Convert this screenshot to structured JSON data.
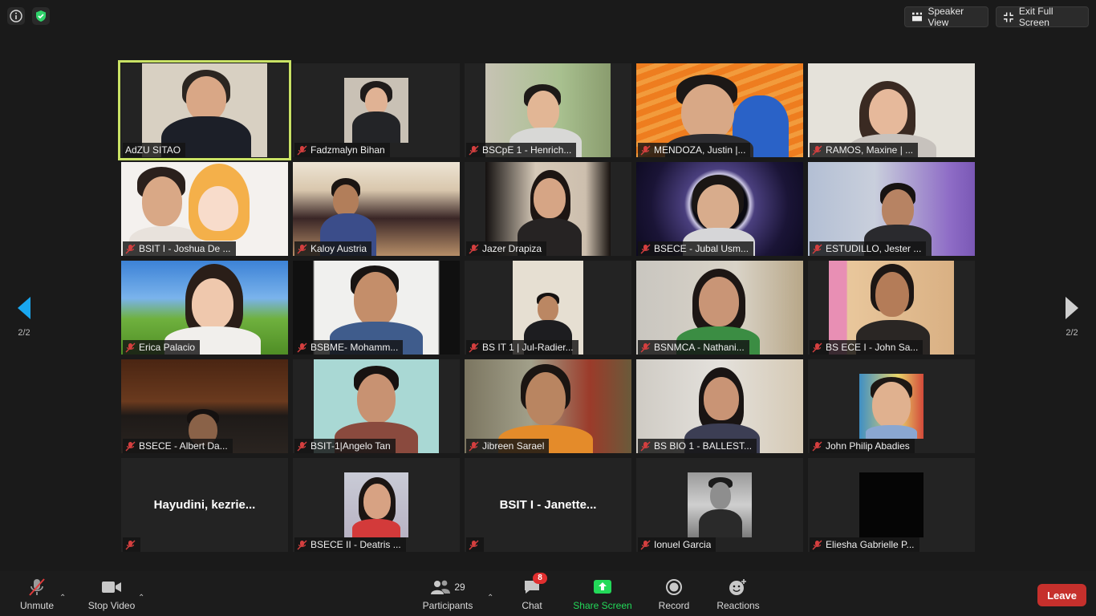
{
  "top": {
    "speaker_view_label": "Speaker View",
    "exit_fullscreen_label": "Exit Full Screen"
  },
  "pager": {
    "left": "2/2",
    "right": "2/2"
  },
  "participants": [
    {
      "name": "AdZU SITAO",
      "muted": false,
      "active": true
    },
    {
      "name": "Fadzmalyn Bihan",
      "muted": true
    },
    {
      "name": "BSCpE 1 - Henrich...",
      "muted": true
    },
    {
      "name": "MENDOZA, Justin |...",
      "muted": true
    },
    {
      "name": "RAMOS, Maxine | ...",
      "muted": true
    },
    {
      "name": "BSIT I - Joshua De ...",
      "muted": true
    },
    {
      "name": "Kaloy Austria",
      "muted": true
    },
    {
      "name": "Jazer Drapiza",
      "muted": true
    },
    {
      "name": "BSECE - Jubal Usm...",
      "muted": true
    },
    {
      "name": "ESTUDILLO, Jester ...",
      "muted": true
    },
    {
      "name": "Erica Palacio",
      "muted": true
    },
    {
      "name": "BSBME- Mohamm...",
      "muted": true
    },
    {
      "name": "BS IT 1 | Jul-Radier...",
      "muted": true
    },
    {
      "name": "BSNMCA - Nathani...",
      "muted": true
    },
    {
      "name": "BS ECE I - John Sa...",
      "muted": true
    },
    {
      "name": "BSECE - Albert Da...",
      "muted": true
    },
    {
      "name": "BSIT-1|Angelo Tan",
      "muted": true
    },
    {
      "name": "Jibreen Sarael",
      "muted": true
    },
    {
      "name": "BS BIO 1 - BALLEST...",
      "muted": true
    },
    {
      "name": "John Philip Abadies",
      "muted": true
    },
    {
      "name": "",
      "display": "Hayudini,  kezrie...",
      "muted": true,
      "novideo": true
    },
    {
      "name": "BSECE II - Deatris ...",
      "muted": true
    },
    {
      "name": "",
      "display": "BSIT I - Janette...",
      "muted": true,
      "novideo": true
    },
    {
      "name": "Ionuel Garcia",
      "muted": true
    },
    {
      "name": "Eliesha Gabrielle P...",
      "muted": true
    }
  ],
  "toolbar": {
    "unmute": "Unmute",
    "stop_video": "Stop Video",
    "participants": "Participants",
    "participants_count": "29",
    "chat": "Chat",
    "chat_badge": "8",
    "share_screen": "Share Screen",
    "record": "Record",
    "reactions": "Reactions",
    "leave": "Leave"
  },
  "colors": {
    "active_border": "#c9e265",
    "share_green": "#23d959",
    "leave_red": "#c6302c"
  }
}
